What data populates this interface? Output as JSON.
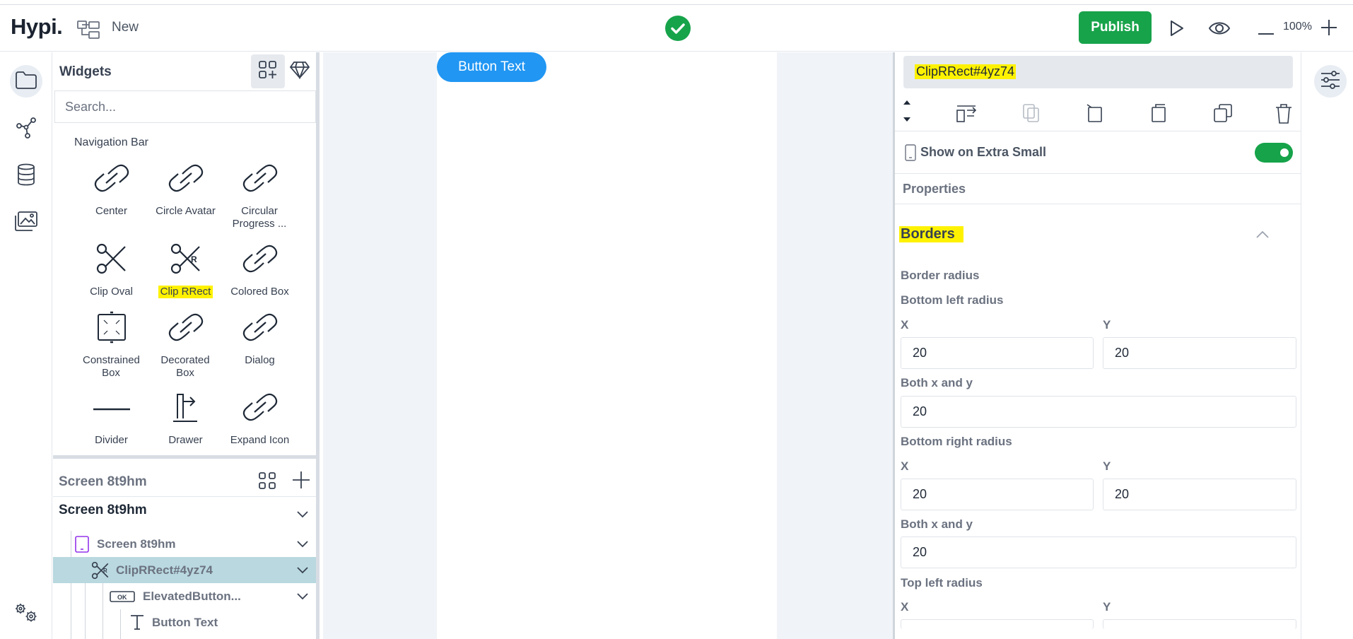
{
  "app": {
    "logo": "Hypi.",
    "project_label": "New"
  },
  "toolbar": {
    "publish_label": "Publish",
    "zoom": "100%"
  },
  "widgets": {
    "title": "Widgets",
    "search_placeholder": "Search...",
    "section_label": "Navigation Bar",
    "items": [
      {
        "label": "Center",
        "icon": "link-icon"
      },
      {
        "label": "Circle Avatar",
        "icon": "link-icon"
      },
      {
        "label": "Circular Progress ...",
        "icon": "link-icon"
      },
      {
        "label": "Clip Oval",
        "icon": "scissors-icon"
      },
      {
        "label": "Clip RRect",
        "icon": "scissors-r-icon"
      },
      {
        "label": "Colored Box",
        "icon": "link-icon"
      },
      {
        "label": "Constrained Box",
        "icon": "expand-box-icon"
      },
      {
        "label": "Decorated Box",
        "icon": "link-icon"
      },
      {
        "label": "Dialog",
        "icon": "link-icon"
      },
      {
        "label": "Divider",
        "icon": "divider-line-icon"
      },
      {
        "label": "Drawer",
        "icon": "drawer-icon"
      },
      {
        "label": "Expand Icon",
        "icon": "link-icon"
      }
    ]
  },
  "tree": {
    "header": "Screen 8t9hm",
    "root": "Screen 8t9hm",
    "rows": [
      {
        "label": "Screen 8t9hm"
      },
      {
        "label": "ClipRRect#4yz74"
      },
      {
        "label": "ElevatedButton..."
      },
      {
        "label": "Button Text"
      }
    ]
  },
  "canvas": {
    "button_text": "Button Text"
  },
  "props": {
    "selected_name": "ClipRRect#4yz74",
    "show_label": "Show on Extra Small",
    "properties_title": "Properties",
    "borders_title": "Borders",
    "border_radius": "Border radius",
    "bottom_left": {
      "title": "Bottom left radius",
      "x_label": "X",
      "y_label": "Y",
      "x": "20",
      "y": "20",
      "both_label": "Both x and y",
      "both": "20"
    },
    "bottom_right": {
      "title": "Bottom right radius",
      "x_label": "X",
      "y_label": "Y",
      "x": "20",
      "y": "20",
      "both_label": "Both x and y",
      "both": "20"
    },
    "top_left": {
      "title": "Top left radius",
      "x_label": "X",
      "y_label": "Y"
    }
  },
  "colors": {
    "accent_green": "#17a34a",
    "canvas_button": "#2196f3",
    "highlight": "#fff200",
    "selected_row": "#b9d8df"
  }
}
